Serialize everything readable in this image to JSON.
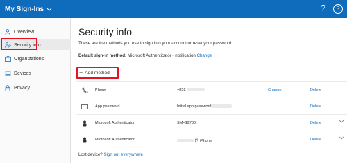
{
  "header": {
    "app_title": "My Sign-Ins",
    "help_glyph": "?",
    "avatar_initial": "R",
    "accent": "#0f6cbd"
  },
  "sidebar": {
    "items": [
      {
        "label": "Overview",
        "icon": "person-icon",
        "active": false
      },
      {
        "label": "Security info",
        "icon": "security-info-icon",
        "active": true
      },
      {
        "label": "Organizations",
        "icon": "briefcase-icon",
        "active": false
      },
      {
        "label": "Devices",
        "icon": "laptop-icon",
        "active": false
      },
      {
        "label": "Privacy",
        "icon": "lock-icon",
        "active": false
      }
    ]
  },
  "main": {
    "title": "Security info",
    "subtitle": "These are the methods you use to sign into your account or reset your password.",
    "default_label": "Default sign-in method:",
    "default_value": "Microsoft Authenticator - notification",
    "default_change": "Change",
    "add_method": "Add method",
    "methods": [
      {
        "icon": "phone-icon",
        "name": "Phone",
        "detail": "+852",
        "change": "Change",
        "delete": "Delete"
      },
      {
        "icon": "password-icon",
        "name": "App password",
        "detail": "Initial app password",
        "delete": "Delete"
      },
      {
        "icon": "authenticator-icon",
        "name": "Microsoft Authenticator",
        "detail": "SM-G9730",
        "delete": "Delete"
      },
      {
        "icon": "authenticator-icon",
        "name": "Microsoft Authenticator",
        "detail": "的 iPhone",
        "delete": "Delete"
      }
    ],
    "lost_device": "Lost device?",
    "sign_out_everywhere": "Sign out everywhere"
  }
}
